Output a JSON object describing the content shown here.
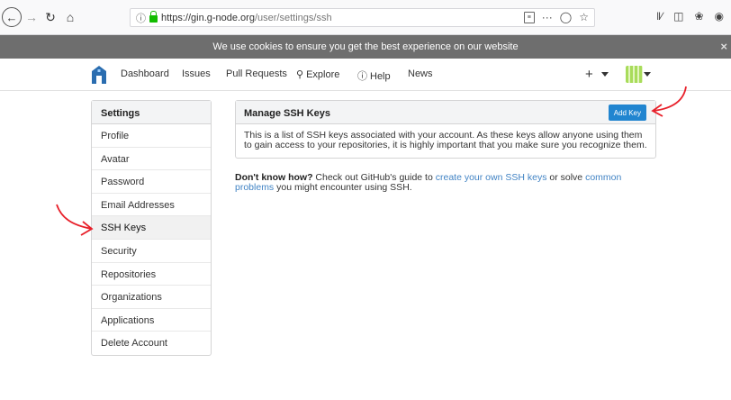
{
  "browser": {
    "url_host": "https://gin.g-node.org",
    "url_path": "/user/settings/ssh",
    "url_tools": "···"
  },
  "cookie": {
    "message": "We use cookies to ensure you get the best experience on our website",
    "close": "×"
  },
  "nav": {
    "dashboard": "Dashboard",
    "issues": "Issues",
    "pull_requests": "Pull Requests",
    "explore": "Explore",
    "help": "Help",
    "news": "News",
    "plus": "+"
  },
  "sidebar": {
    "title": "Settings",
    "items": [
      {
        "label": "Profile"
      },
      {
        "label": "Avatar"
      },
      {
        "label": "Password"
      },
      {
        "label": "Email Addresses"
      },
      {
        "label": "SSH Keys",
        "active": true
      },
      {
        "label": "Security"
      },
      {
        "label": "Repositories"
      },
      {
        "label": "Organizations"
      },
      {
        "label": "Applications"
      },
      {
        "label": "Delete Account"
      }
    ]
  },
  "panel": {
    "title": "Manage SSH Keys",
    "add_key": "Add Key",
    "body": "This is a list of SSH keys associated with your account. As these keys allow anyone using them to gain access to your repositories, it is highly important that you make sure you recognize them."
  },
  "help": {
    "bold": "Don't know how?",
    "text1": " Check out GitHub's guide to ",
    "link1": "create your own SSH keys",
    "text2": " or solve ",
    "link2": "common problems",
    "text3": " you might encounter using SSH."
  },
  "colors": {
    "accent": "#2185d0",
    "link": "#4183c4",
    "annotation": "#e8202a",
    "banner": "#6e6e6e"
  }
}
